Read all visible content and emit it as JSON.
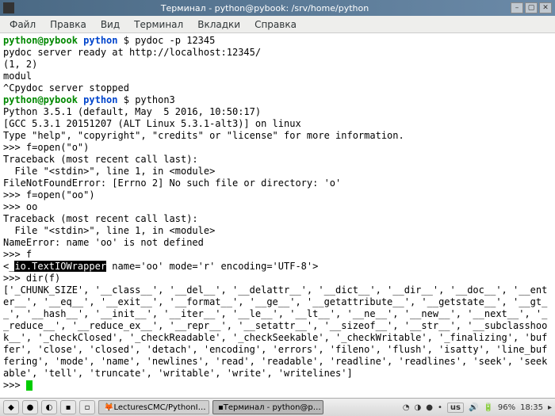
{
  "window": {
    "title": "Терминал - python@pybook: /srv/home/python"
  },
  "menu": {
    "file": "Файл",
    "edit": "Правка",
    "view": "Вид",
    "terminal": "Терминал",
    "tabs": "Вкладки",
    "help": "Справка"
  },
  "term": {
    "prompt_user": "python@pybook",
    "prompt_path": "python",
    "dollar": " $ ",
    "cmd1": "pydoc -p 12345",
    "out1": "pydoc server ready at http://localhost:12345/",
    "out2": "(1, 2)",
    "out3": "modul",
    "out4": "^Cpydoc server stopped",
    "cmd2": "python3",
    "py1": "Python 3.5.1 (default, May  5 2016, 10:50:17)",
    "py2": "[GCC 5.3.1 20151207 (ALT Linux 5.3.1-alt3)] on linux",
    "py3": "Type \"help\", \"copyright\", \"credits\" or \"license\" for more information.",
    "ps1": ">>> ",
    "in1": "f=open(\"o\")",
    "tb1": "Traceback (most recent call last):",
    "tb2": "  File \"<stdin>\", line 1, in <module>",
    "err1": "FileNotFoundError: [Errno 2] No such file or directory: 'o'",
    "in2": "f=open(\"oo\")",
    "in3": "oo",
    "err2": "NameError: name 'oo' is not defined",
    "in4": "f",
    "wrap_pre": "<_",
    "wrap_hl": "io.TextIOWrapper",
    "wrap_post": " name='oo' mode='r' encoding='UTF-8'>",
    "in5": "dir(f)",
    "dir_out": "['_CHUNK_SIZE', '__class__', '__del__', '__delattr__', '__dict__', '__dir__', '__doc__', '__enter__', '__eq__', '__exit__', '__format__', '__ge__', '__getattribute__', '__getstate__', '__gt__', '__hash__', '__init__', '__iter__', '__le__', '__lt__', '__ne__', '__new__', '__next__', '__reduce__', '__reduce_ex__', '__repr__', '__setattr__', '__sizeof__', '__str__', '__subclasshook__', '_checkClosed', '_checkReadable', '_checkSeekable', '_checkWritable', '_finalizing', 'buffer', 'close', 'closed', 'detach', 'encoding', 'errors', 'fileno', 'flush', 'isatty', 'line_buffering', 'mode', 'name', 'newlines', 'read', 'readable', 'readline', 'readlines', 'seek', 'seekable', 'tell', 'truncate', 'writable', 'write', 'writelines']"
  },
  "panel": {
    "task1": "LecturesCMC/PythonI…",
    "task2": "Терминал - python@p…",
    "kb": "us",
    "battery": "96%",
    "time": "18:35"
  }
}
